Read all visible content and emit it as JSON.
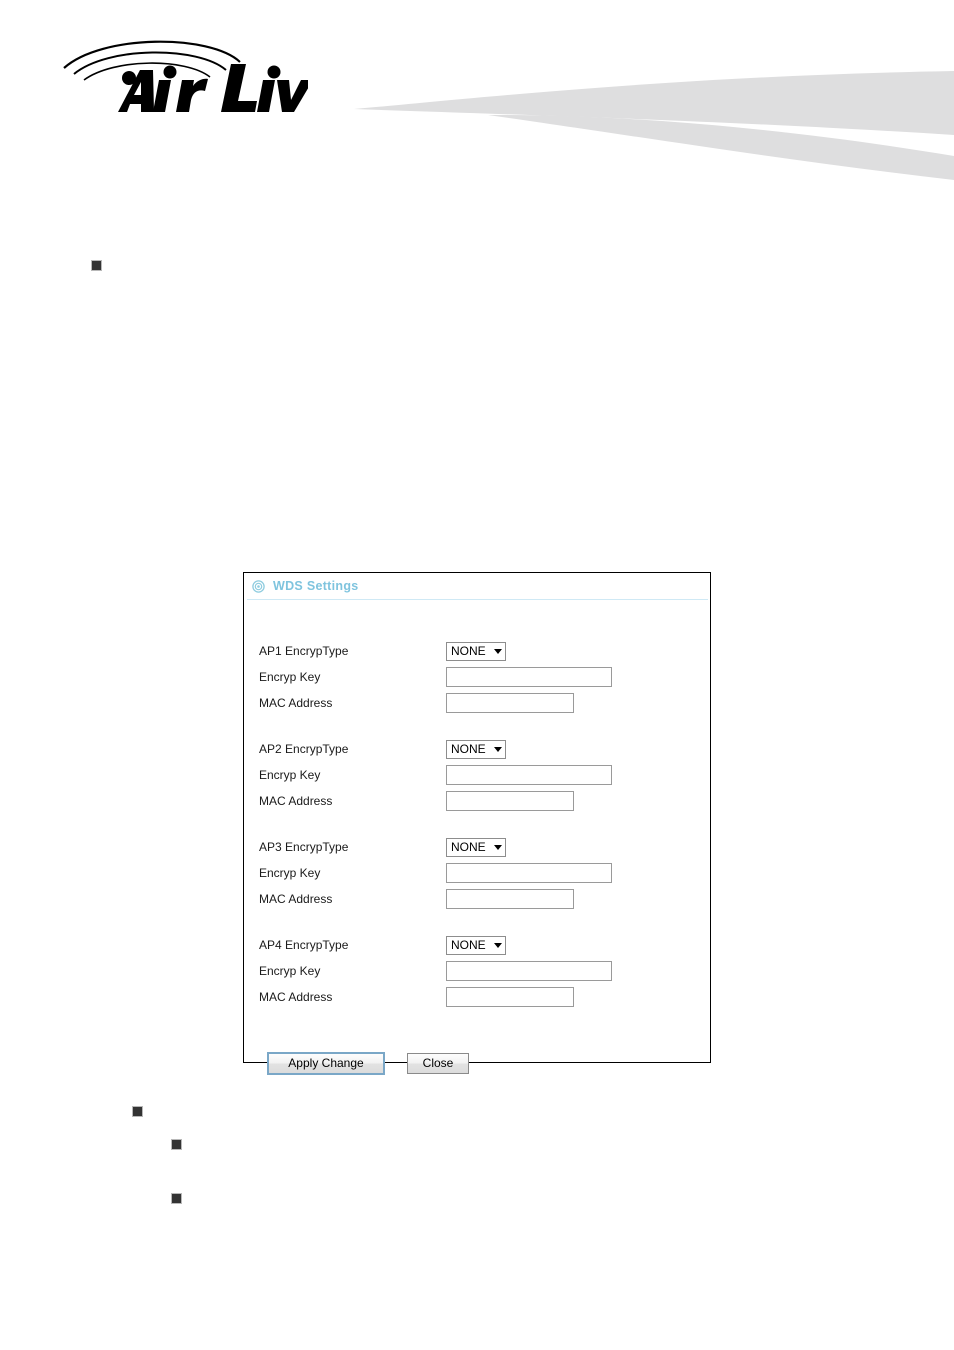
{
  "header": {
    "brand_name": "Air Live",
    "brand_trademark": "®",
    "logo_icon": "airlive-wave-logo",
    "swoosh_icon": "header-swoosh-ribbon",
    "swoosh_color": "#dededf"
  },
  "document_bullets": [
    {
      "name": "bullet-marker-top"
    },
    {
      "name": "bullet-marker-lower-1"
    },
    {
      "name": "bullet-marker-lower-2"
    },
    {
      "name": "bullet-marker-lower-3"
    }
  ],
  "panel": {
    "title": "WDS Settings",
    "title_icon": "target-circle-icon",
    "title_color": "#7fc4de",
    "border_color": "#000000",
    "divider_color": "#cfe9f5"
  },
  "ap_groups": [
    {
      "encryp_type_label": "AP1 EncrypType",
      "encryp_type_value": "NONE",
      "encryp_key_label": "Encryp Key",
      "encryp_key_value": "",
      "encryp_key_placeholder": "",
      "mac_address_label": "MAC Address",
      "mac_address_value": "",
      "mac_address_placeholder": ""
    },
    {
      "encryp_type_label": "AP2 EncrypType",
      "encryp_type_value": "NONE",
      "encryp_key_label": "Encryp Key",
      "encryp_key_value": "",
      "encryp_key_placeholder": "",
      "mac_address_label": "MAC Address",
      "mac_address_value": "",
      "mac_address_placeholder": ""
    },
    {
      "encryp_type_label": "AP3 EncrypType",
      "encryp_type_value": "NONE",
      "encryp_key_label": "Encryp Key",
      "encryp_key_value": "",
      "encryp_key_placeholder": "",
      "mac_address_label": "MAC Address",
      "mac_address_value": "",
      "mac_address_placeholder": ""
    },
    {
      "encryp_type_label": "AP4 EncrypType",
      "encryp_type_value": "NONE",
      "encryp_key_label": "Encryp Key",
      "encryp_key_value": "",
      "encryp_key_placeholder": "",
      "mac_address_label": "MAC Address",
      "mac_address_value": "",
      "mac_address_placeholder": ""
    }
  ],
  "actions": {
    "apply_label": "Apply Change",
    "close_label": "Close",
    "apply_focus_color": "#7aa7c7"
  },
  "encryp_type_options": [
    "NONE"
  ]
}
